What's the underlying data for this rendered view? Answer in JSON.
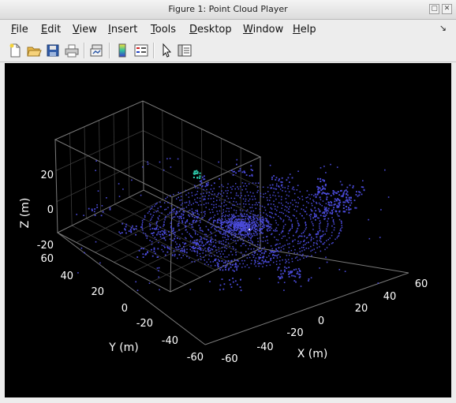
{
  "window": {
    "title": "Figure 1: Point Cloud Player"
  },
  "window_buttons": {
    "restore": "▢",
    "close": "✕"
  },
  "menus": [
    {
      "label": "File",
      "mnemonic": "F",
      "rest": "ile"
    },
    {
      "label": "Edit",
      "mnemonic": "E",
      "rest": "dit"
    },
    {
      "label": "View",
      "mnemonic": "V",
      "rest": "iew"
    },
    {
      "label": "Insert",
      "mnemonic": "I",
      "rest": "nsert"
    },
    {
      "label": "Tools",
      "mnemonic": "T",
      "rest": "ools"
    },
    {
      "label": "Desktop",
      "mnemonic": "D",
      "rest": "esktop"
    },
    {
      "label": "Window",
      "mnemonic": "W",
      "rest": "indow"
    },
    {
      "label": "Help",
      "mnemonic": "H",
      "rest": "elp"
    }
  ],
  "dock_glyph": "↘",
  "toolbar": {
    "tools": [
      "new-figure",
      "open-file",
      "save-figure",
      "print-figure",
      "link-plot",
      "insert-colorbar",
      "insert-legend",
      "edit-plot",
      "property-inspector"
    ]
  },
  "plot": {
    "background": "#000000",
    "point_color": "#4a4ad8",
    "highlight_color": "#2fd0b0",
    "z_axis": {
      "label": "Z (m)",
      "ticks": [
        "20",
        "0",
        "-20"
      ]
    },
    "y_axis": {
      "label": "Y (m)",
      "ticks": [
        "60",
        "40",
        "20",
        "0",
        "-20",
        "-40",
        "-60"
      ]
    },
    "x_axis": {
      "label": "X (m)",
      "ticks": [
        "-60",
        "-40",
        "-20",
        "0",
        "20",
        "40",
        "60"
      ]
    },
    "grid": true
  }
}
